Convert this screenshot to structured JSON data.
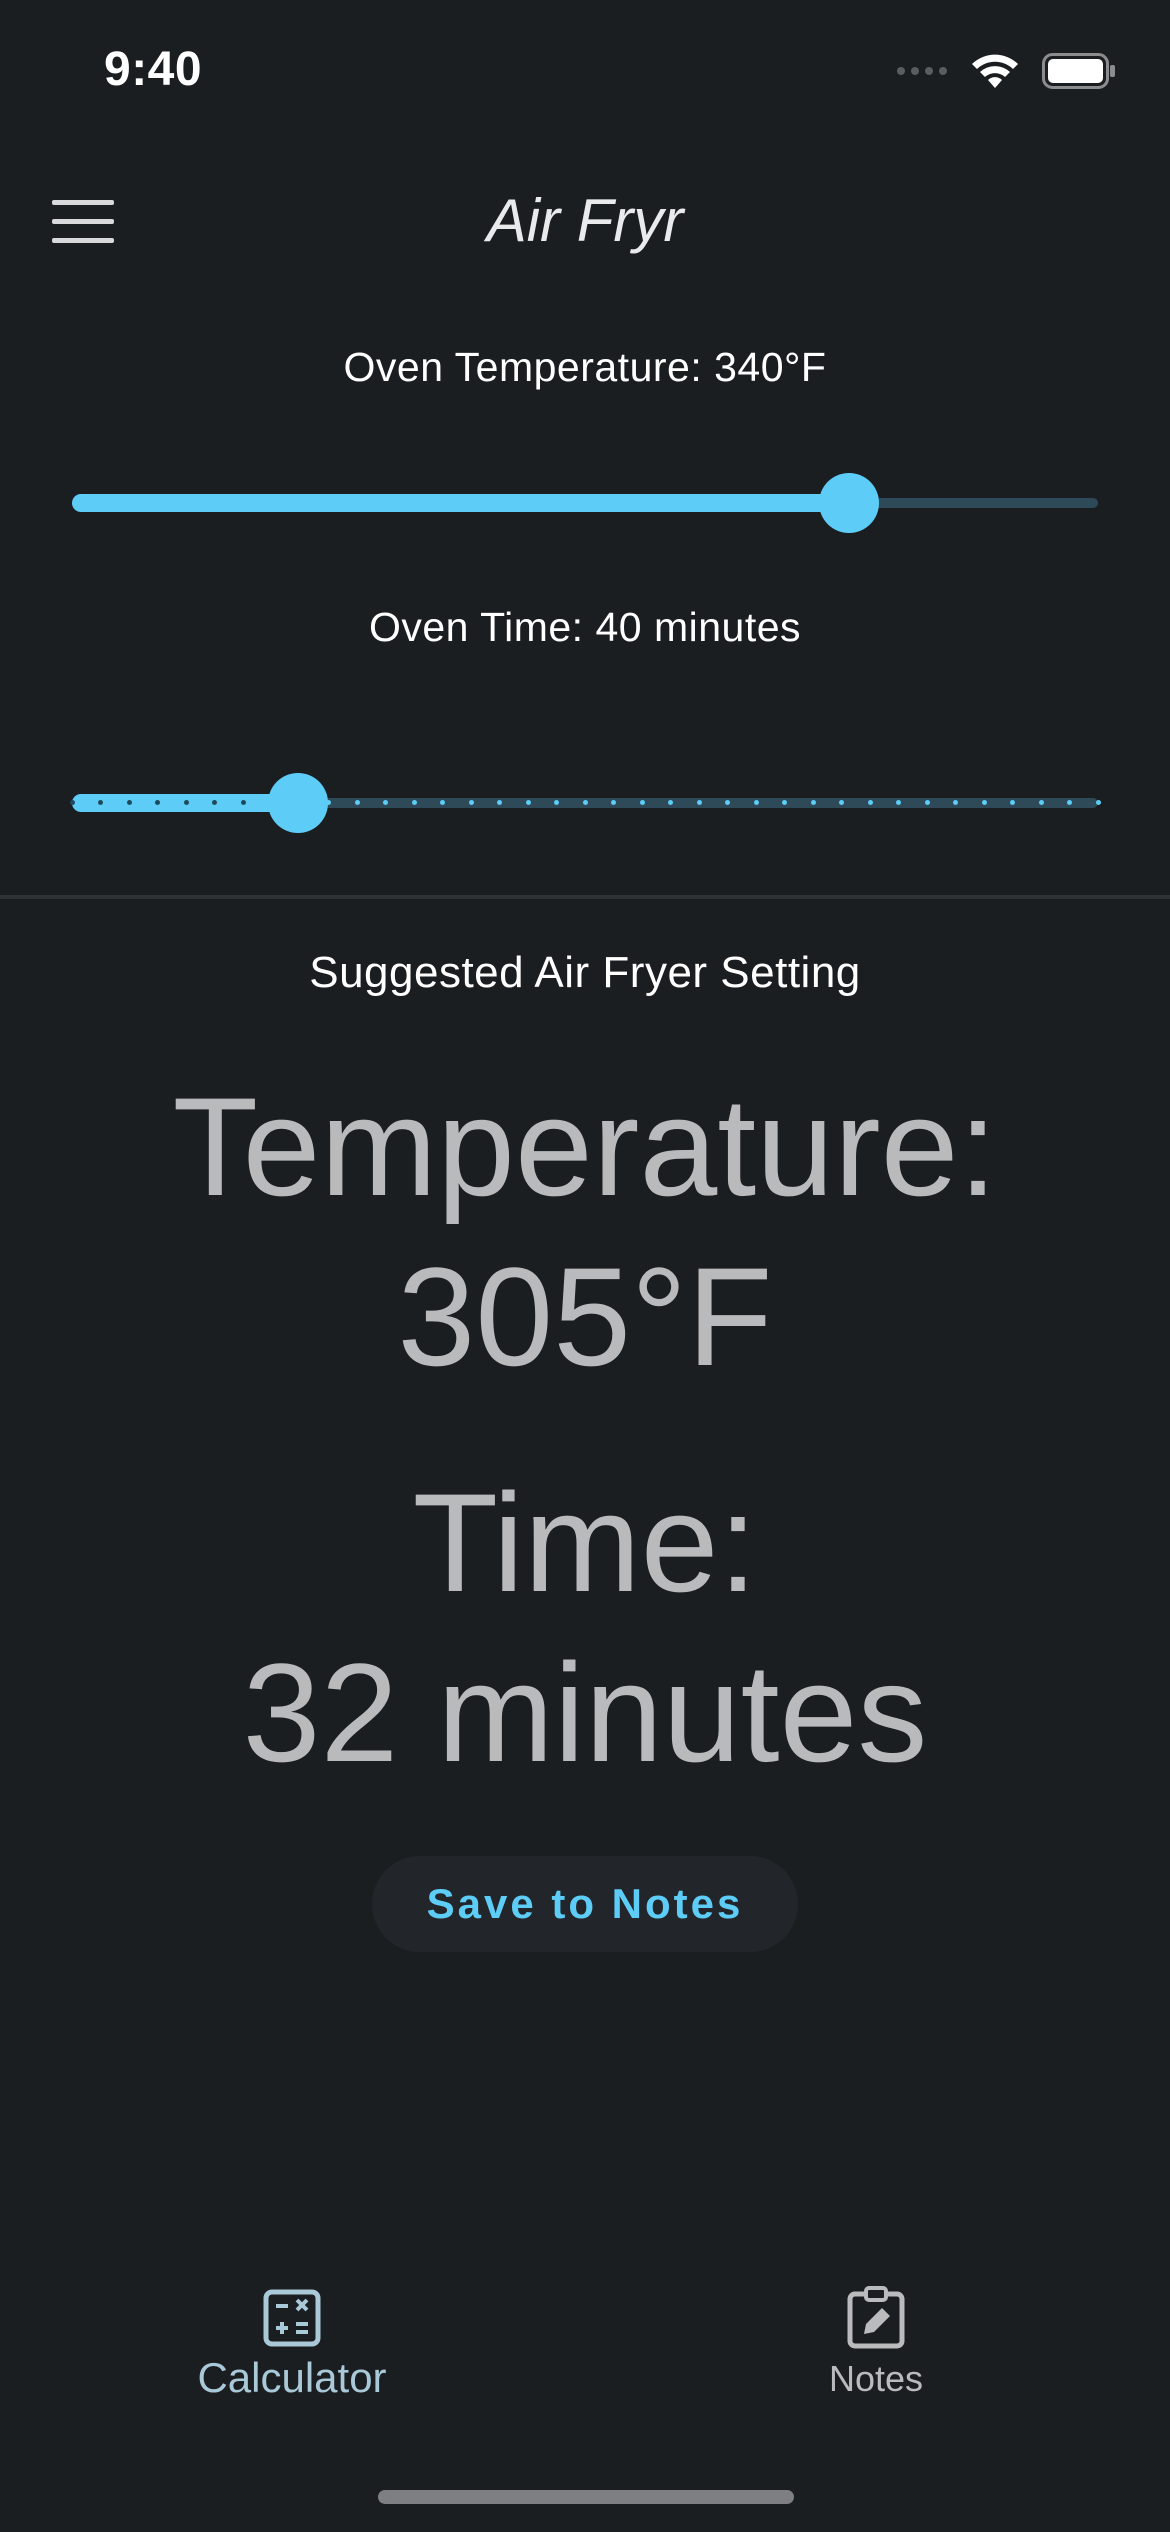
{
  "status_bar": {
    "time": "9:40"
  },
  "header": {
    "title": "Air Fryr",
    "menu_icon": "hamburger-menu-icon"
  },
  "oven_temperature": {
    "label": "Oven Temperature: 340°F",
    "slider_fraction": 0.757
  },
  "oven_time": {
    "label": "Oven Time: 40 minutes",
    "slider_fraction": 0.22,
    "ticks": 37
  },
  "result": {
    "heading": "Suggested Air Fryer Setting",
    "temp_label": "Temperature:",
    "temp_value": "305°F",
    "time_label": "Time:",
    "time_value": "32 minutes"
  },
  "save_button": {
    "label": "Save to Notes"
  },
  "bottom_nav": {
    "items": [
      {
        "label": "Calculator",
        "icon": "calculator-icon",
        "active": true
      },
      {
        "label": "Notes",
        "icon": "clipboard-edit-icon",
        "active": false
      }
    ]
  },
  "colors": {
    "accent": "#5dcdf7",
    "background": "#1b1e21"
  }
}
